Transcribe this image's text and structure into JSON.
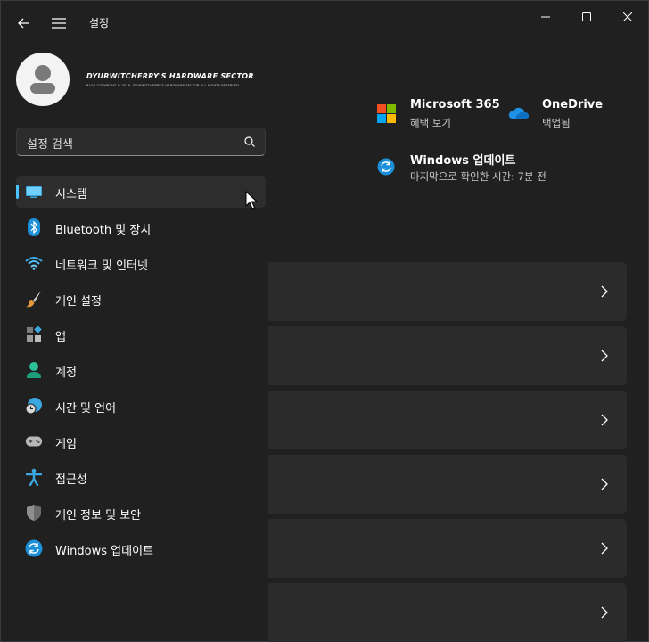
{
  "window": {
    "title": "설정",
    "controls": [
      "minimize-icon",
      "maximize-icon",
      "close-icon"
    ]
  },
  "profile": {
    "name": "DYURWITCHERRY'S HARDWARE SECTOR",
    "subtitle": "BLOG COPYRIGHT © 2019. DYURWITCHERRY'S HARDWARE SECTOR ALL RIGHTS RESERVED."
  },
  "search": {
    "placeholder": "설정 검색"
  },
  "nav": {
    "items": [
      {
        "label": "시스템",
        "icon": "system-display-icon",
        "selected": true
      },
      {
        "label": "Bluetooth 및 장치",
        "icon": "bluetooth-icon"
      },
      {
        "label": "네트워크 및 인터넷",
        "icon": "wifi-icon"
      },
      {
        "label": "개인 설정",
        "icon": "paintbrush-icon"
      },
      {
        "label": "앱",
        "icon": "apps-icon"
      },
      {
        "label": "계정",
        "icon": "account-icon"
      },
      {
        "label": "시간 및 언어",
        "icon": "globe-clock-icon"
      },
      {
        "label": "게임",
        "icon": "gamepad-icon"
      },
      {
        "label": "접근성",
        "icon": "accessibility-icon"
      },
      {
        "label": "개인 정보 및 보안",
        "icon": "shield-icon"
      },
      {
        "label": "Windows 업데이트",
        "icon": "windows-update-icon"
      }
    ]
  },
  "tiles": {
    "microsoft365": {
      "title": "Microsoft 365",
      "subtitle": "혜택 보기",
      "icon": "microsoft-logo-icon"
    },
    "onedrive": {
      "title": "OneDrive",
      "subtitle": "백업됨",
      "icon": "onedrive-cloud-icon"
    },
    "update": {
      "title": "Windows 업데이트",
      "subtitle": "마지막으로 확인한 시간: 7분 전",
      "icon": "windows-update-icon"
    }
  },
  "colors": {
    "accent": "#4cc2ff",
    "background": "#202020",
    "panel": "#2b2b2b"
  }
}
